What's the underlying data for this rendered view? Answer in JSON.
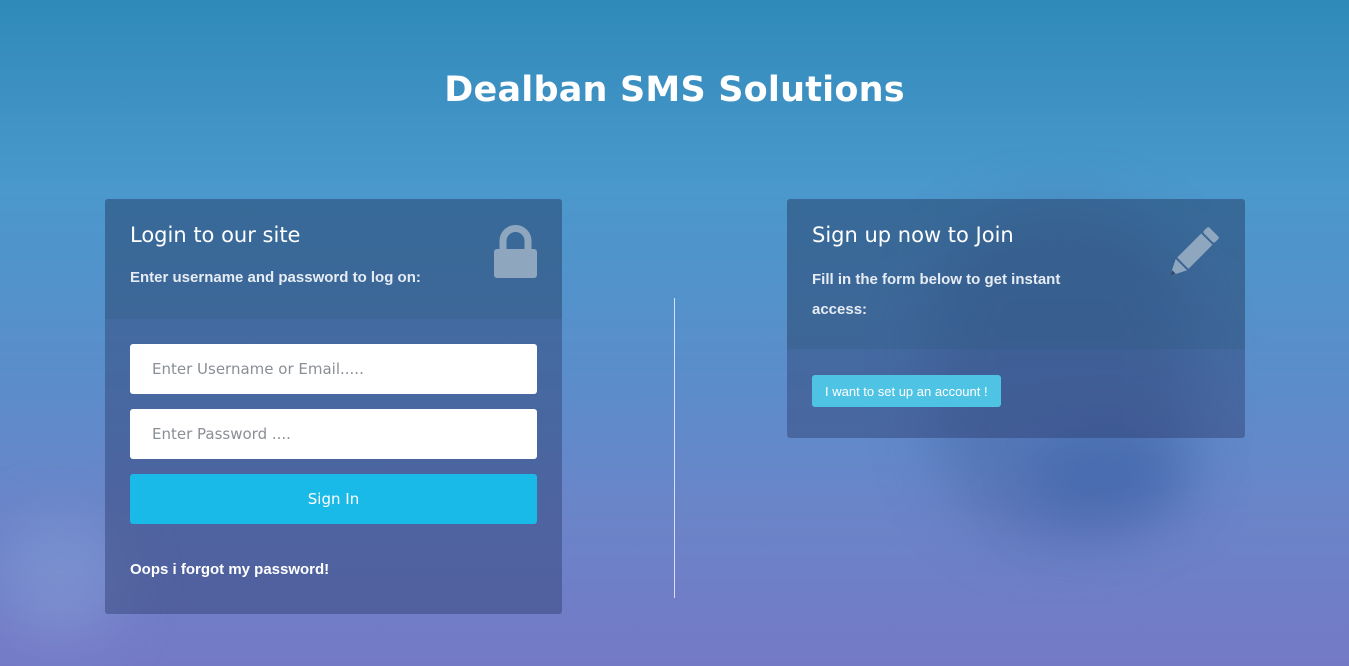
{
  "site": {
    "title": "Dealban SMS Solutions"
  },
  "login": {
    "heading": "Login to our site",
    "subheading": "Enter username and password to log on:",
    "icon": "lock-icon",
    "username_placeholder": "Enter Username or Email.....",
    "username_value": "",
    "password_placeholder": "Enter Password ....",
    "password_value": "",
    "signin_label": "Sign In",
    "forgot_label": "Oops i forgot my password!"
  },
  "signup": {
    "heading": "Sign up now to Join",
    "subheading": "Fill in the form below to get instant access:",
    "icon": "pencil-icon",
    "button_label": "I want to set up an account !"
  },
  "colors": {
    "primary_button": "#19b9e8",
    "secondary_button": "#4fc3e4",
    "text": "#ffffff"
  }
}
